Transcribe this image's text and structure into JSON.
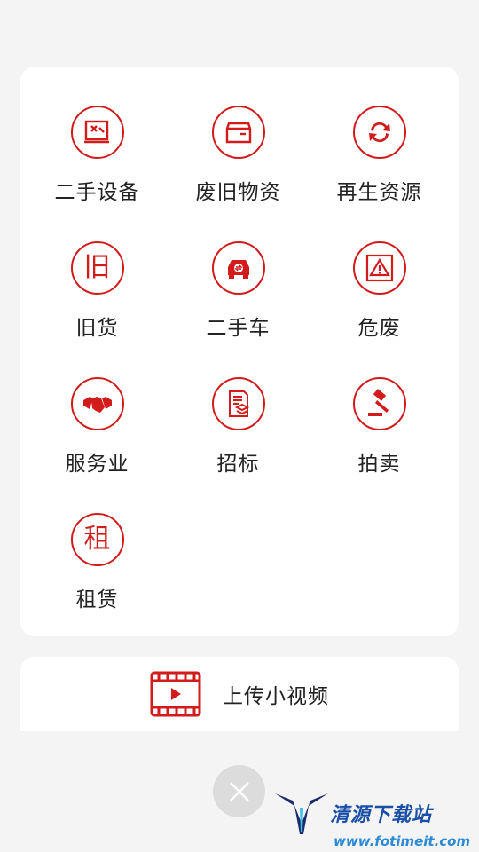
{
  "categories": [
    {
      "label": "二手设备",
      "icon": "equipment-icon"
    },
    {
      "label": "废旧物资",
      "icon": "box-icon"
    },
    {
      "label": "再生资源",
      "icon": "recycle-icon"
    },
    {
      "label": "旧货",
      "icon": "jiu-character-icon",
      "glyph": "旧"
    },
    {
      "label": "二手车",
      "icon": "car-icon"
    },
    {
      "label": "危废",
      "icon": "warning-icon"
    },
    {
      "label": "服务业",
      "icon": "handshake-icon"
    },
    {
      "label": "招标",
      "icon": "document-icon"
    },
    {
      "label": "拍卖",
      "icon": "gavel-icon"
    },
    {
      "label": "租赁",
      "icon": "zu-character-icon",
      "glyph": "租"
    }
  ],
  "video": {
    "label": "上传小视频",
    "icon": "video-icon"
  },
  "close": {
    "icon": "close-icon"
  },
  "watermark": {
    "title": "清源下载站",
    "url": "www.fotimeit.com"
  },
  "colors": {
    "accent": "#d21b1b",
    "background": "#f4f4f4",
    "panel": "#ffffff",
    "close_button": "#dcdcdc"
  }
}
